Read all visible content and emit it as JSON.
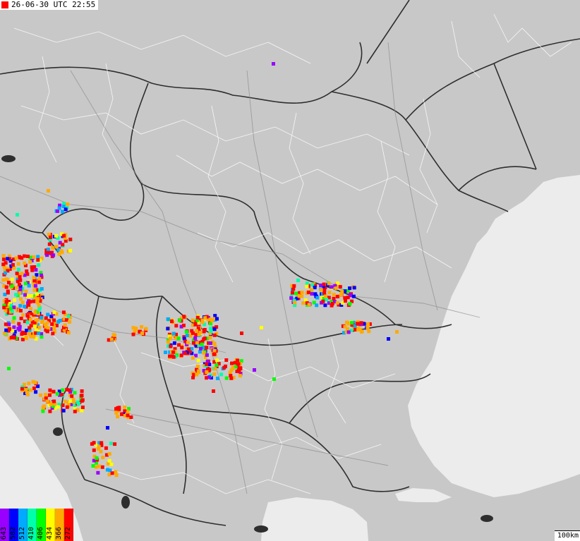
{
  "header": {
    "timestamp": "26-06-30 UTC 22:55",
    "marker_color": "#ff0000"
  },
  "map": {
    "land_color": "#c8c8c8",
    "sea_color": "#ececec",
    "border_color": "#2e2e2e",
    "region_line_color": "#ffffff",
    "scale_label": "100km"
  },
  "legend": {
    "items": [
      {
        "label": "643",
        "color": "#9900ff"
      },
      {
        "label": "582",
        "color": "#0000ff"
      },
      {
        "label": "512",
        "color": "#00aaff"
      },
      {
        "label": "410",
        "color": "#00ffaa"
      },
      {
        "label": "406",
        "color": "#00ff00"
      },
      {
        "label": "434",
        "color": "#ffff00"
      },
      {
        "label": "366",
        "color": "#ffaa00"
      },
      {
        "label": "272",
        "color": "#ff0000"
      }
    ]
  }
}
